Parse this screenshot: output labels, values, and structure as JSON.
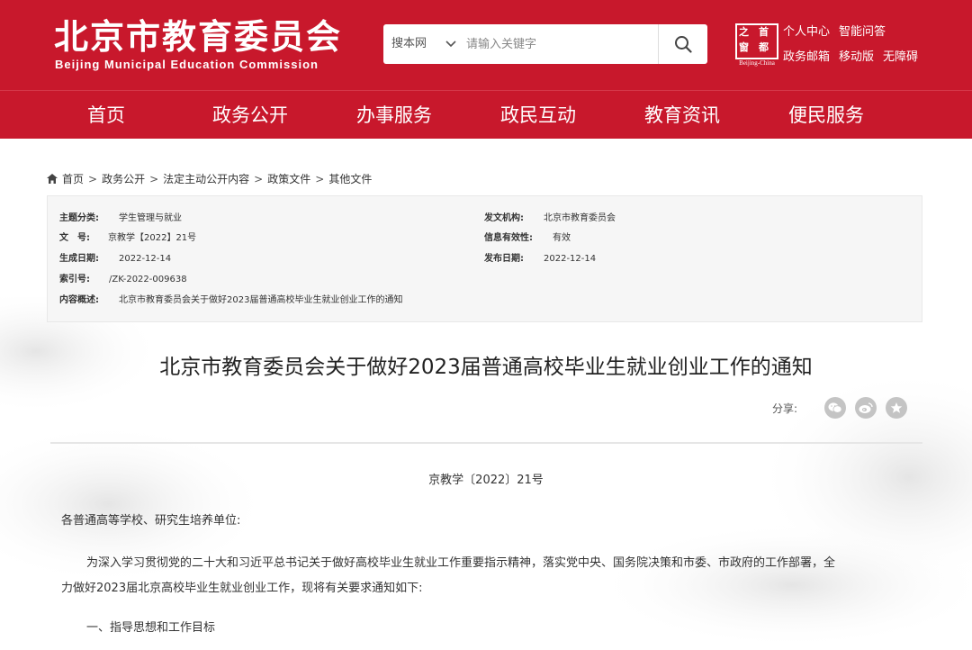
{
  "header": {
    "logo_cn": "北京市教育委员会",
    "logo_en": "Beijing Municipal Education Commission",
    "search": {
      "scope": "搜本网",
      "placeholder": "请输入关键字"
    },
    "emblem": {
      "chars": [
        "之",
        "首",
        "都",
        "窗"
      ],
      "en": "Beijing-China"
    },
    "links_row1": [
      "个人中心",
      "智能问答"
    ],
    "links_row2": [
      "政务邮箱",
      "移动版",
      "无障碍"
    ]
  },
  "nav": {
    "items": [
      "首页",
      "政务公开",
      "办事服务",
      "政民互动",
      "教育资讯",
      "便民服务"
    ]
  },
  "breadcrumb": [
    "首页",
    "政务公开",
    "法定主动公开内容",
    "政策文件",
    "其他文件"
  ],
  "info": {
    "topic_label": "主题分类:",
    "topic_value": "学生管理与就业",
    "issuer_label": "发文机构:",
    "issuer_value": "北京市教育委员会",
    "docno_label": "文　号:",
    "docno_value": "京教学【2022】21号",
    "validity_label": "信息有效性:",
    "validity_value": "有效",
    "created_label": "生成日期:",
    "created_value": "2022-12-14",
    "published_label": "发布日期:",
    "published_value": "2022-12-14",
    "index_label": "索引号:",
    "index_value": "/ZK-2022-009638",
    "summary_label": "内容概述:",
    "summary_value": "北京市教育委员会关于做好2023届普通高校毕业生就业创业工作的通知"
  },
  "article": {
    "title": "北京市教育委员会关于做好2023届普通高校毕业生就业创业工作的通知",
    "share_label": "分享:",
    "share_icons": [
      "wechat-icon",
      "weibo-icon",
      "favorite-icon"
    ],
    "doc_number": "京教学〔2022〕21号",
    "salutation": "各普通高等学校、研究生培养单位:",
    "para1_line1": "为深入学习贯彻党的二十大和习近平总书记关于做好高校毕业生就业工作重要指示精神，落实党中央、国务院决策和市委、市政府的工作部署，全",
    "para1_line2": "力做好2023届北京高校毕业生就业创业工作，现将有关要求通知如下:",
    "section1": "一、指导思想和工作目标"
  },
  "colors": {
    "brand_red": "#c8182c",
    "info_bg": "#f6f6f6",
    "share_icon_bg": "#c4c4c4"
  }
}
